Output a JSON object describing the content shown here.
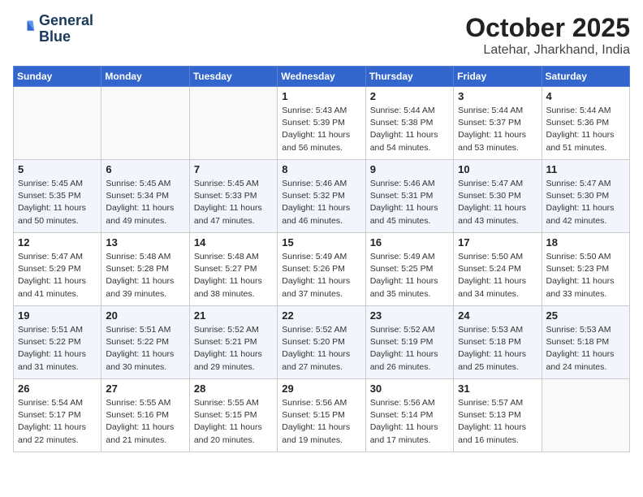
{
  "header": {
    "logo_line1": "General",
    "logo_line2": "Blue",
    "month": "October 2025",
    "location": "Latehar, Jharkhand, India"
  },
  "weekdays": [
    "Sunday",
    "Monday",
    "Tuesday",
    "Wednesday",
    "Thursday",
    "Friday",
    "Saturday"
  ],
  "weeks": [
    [
      {
        "day": "",
        "sunrise": "",
        "sunset": "",
        "daylight": ""
      },
      {
        "day": "",
        "sunrise": "",
        "sunset": "",
        "daylight": ""
      },
      {
        "day": "",
        "sunrise": "",
        "sunset": "",
        "daylight": ""
      },
      {
        "day": "1",
        "sunrise": "Sunrise: 5:43 AM",
        "sunset": "Sunset: 5:39 PM",
        "daylight": "Daylight: 11 hours and 56 minutes."
      },
      {
        "day": "2",
        "sunrise": "Sunrise: 5:44 AM",
        "sunset": "Sunset: 5:38 PM",
        "daylight": "Daylight: 11 hours and 54 minutes."
      },
      {
        "day": "3",
        "sunrise": "Sunrise: 5:44 AM",
        "sunset": "Sunset: 5:37 PM",
        "daylight": "Daylight: 11 hours and 53 minutes."
      },
      {
        "day": "4",
        "sunrise": "Sunrise: 5:44 AM",
        "sunset": "Sunset: 5:36 PM",
        "daylight": "Daylight: 11 hours and 51 minutes."
      }
    ],
    [
      {
        "day": "5",
        "sunrise": "Sunrise: 5:45 AM",
        "sunset": "Sunset: 5:35 PM",
        "daylight": "Daylight: 11 hours and 50 minutes."
      },
      {
        "day": "6",
        "sunrise": "Sunrise: 5:45 AM",
        "sunset": "Sunset: 5:34 PM",
        "daylight": "Daylight: 11 hours and 49 minutes."
      },
      {
        "day": "7",
        "sunrise": "Sunrise: 5:45 AM",
        "sunset": "Sunset: 5:33 PM",
        "daylight": "Daylight: 11 hours and 47 minutes."
      },
      {
        "day": "8",
        "sunrise": "Sunrise: 5:46 AM",
        "sunset": "Sunset: 5:32 PM",
        "daylight": "Daylight: 11 hours and 46 minutes."
      },
      {
        "day": "9",
        "sunrise": "Sunrise: 5:46 AM",
        "sunset": "Sunset: 5:31 PM",
        "daylight": "Daylight: 11 hours and 45 minutes."
      },
      {
        "day": "10",
        "sunrise": "Sunrise: 5:47 AM",
        "sunset": "Sunset: 5:30 PM",
        "daylight": "Daylight: 11 hours and 43 minutes."
      },
      {
        "day": "11",
        "sunrise": "Sunrise: 5:47 AM",
        "sunset": "Sunset: 5:30 PM",
        "daylight": "Daylight: 11 hours and 42 minutes."
      }
    ],
    [
      {
        "day": "12",
        "sunrise": "Sunrise: 5:47 AM",
        "sunset": "Sunset: 5:29 PM",
        "daylight": "Daylight: 11 hours and 41 minutes."
      },
      {
        "day": "13",
        "sunrise": "Sunrise: 5:48 AM",
        "sunset": "Sunset: 5:28 PM",
        "daylight": "Daylight: 11 hours and 39 minutes."
      },
      {
        "day": "14",
        "sunrise": "Sunrise: 5:48 AM",
        "sunset": "Sunset: 5:27 PM",
        "daylight": "Daylight: 11 hours and 38 minutes."
      },
      {
        "day": "15",
        "sunrise": "Sunrise: 5:49 AM",
        "sunset": "Sunset: 5:26 PM",
        "daylight": "Daylight: 11 hours and 37 minutes."
      },
      {
        "day": "16",
        "sunrise": "Sunrise: 5:49 AM",
        "sunset": "Sunset: 5:25 PM",
        "daylight": "Daylight: 11 hours and 35 minutes."
      },
      {
        "day": "17",
        "sunrise": "Sunrise: 5:50 AM",
        "sunset": "Sunset: 5:24 PM",
        "daylight": "Daylight: 11 hours and 34 minutes."
      },
      {
        "day": "18",
        "sunrise": "Sunrise: 5:50 AM",
        "sunset": "Sunset: 5:23 PM",
        "daylight": "Daylight: 11 hours and 33 minutes."
      }
    ],
    [
      {
        "day": "19",
        "sunrise": "Sunrise: 5:51 AM",
        "sunset": "Sunset: 5:22 PM",
        "daylight": "Daylight: 11 hours and 31 minutes."
      },
      {
        "day": "20",
        "sunrise": "Sunrise: 5:51 AM",
        "sunset": "Sunset: 5:22 PM",
        "daylight": "Daylight: 11 hours and 30 minutes."
      },
      {
        "day": "21",
        "sunrise": "Sunrise: 5:52 AM",
        "sunset": "Sunset: 5:21 PM",
        "daylight": "Daylight: 11 hours and 29 minutes."
      },
      {
        "day": "22",
        "sunrise": "Sunrise: 5:52 AM",
        "sunset": "Sunset: 5:20 PM",
        "daylight": "Daylight: 11 hours and 27 minutes."
      },
      {
        "day": "23",
        "sunrise": "Sunrise: 5:52 AM",
        "sunset": "Sunset: 5:19 PM",
        "daylight": "Daylight: 11 hours and 26 minutes."
      },
      {
        "day": "24",
        "sunrise": "Sunrise: 5:53 AM",
        "sunset": "Sunset: 5:18 PM",
        "daylight": "Daylight: 11 hours and 25 minutes."
      },
      {
        "day": "25",
        "sunrise": "Sunrise: 5:53 AM",
        "sunset": "Sunset: 5:18 PM",
        "daylight": "Daylight: 11 hours and 24 minutes."
      }
    ],
    [
      {
        "day": "26",
        "sunrise": "Sunrise: 5:54 AM",
        "sunset": "Sunset: 5:17 PM",
        "daylight": "Daylight: 11 hours and 22 minutes."
      },
      {
        "day": "27",
        "sunrise": "Sunrise: 5:55 AM",
        "sunset": "Sunset: 5:16 PM",
        "daylight": "Daylight: 11 hours and 21 minutes."
      },
      {
        "day": "28",
        "sunrise": "Sunrise: 5:55 AM",
        "sunset": "Sunset: 5:15 PM",
        "daylight": "Daylight: 11 hours and 20 minutes."
      },
      {
        "day": "29",
        "sunrise": "Sunrise: 5:56 AM",
        "sunset": "Sunset: 5:15 PM",
        "daylight": "Daylight: 11 hours and 19 minutes."
      },
      {
        "day": "30",
        "sunrise": "Sunrise: 5:56 AM",
        "sunset": "Sunset: 5:14 PM",
        "daylight": "Daylight: 11 hours and 17 minutes."
      },
      {
        "day": "31",
        "sunrise": "Sunrise: 5:57 AM",
        "sunset": "Sunset: 5:13 PM",
        "daylight": "Daylight: 11 hours and 16 minutes."
      },
      {
        "day": "",
        "sunrise": "",
        "sunset": "",
        "daylight": ""
      }
    ]
  ]
}
